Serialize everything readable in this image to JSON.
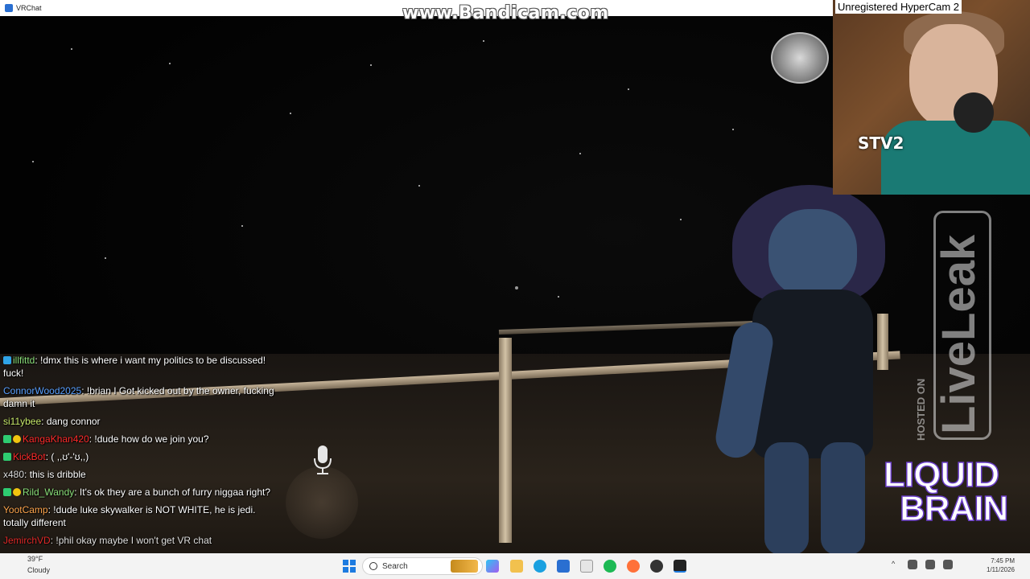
{
  "window": {
    "title": "VRChat"
  },
  "watermarks": {
    "bandicam": "www.Bandicam.com",
    "hypercam": "Unregistered HyperCam 2",
    "liveleak_hosted": "HOSTED ON",
    "liveleak": "LiveLeak",
    "liquid_brain_1": "LIQUID",
    "liquid_brain_2": "BRAIN",
    "stv": "STV2"
  },
  "chat": [
    {
      "user": "illfittd",
      "user_color": "#8be07a",
      "text": "!dmx this is where i want my politics to be discussed! fuck!"
    },
    {
      "user": "ConnorWood2025",
      "user_color": "#5aa0ff",
      "text": "!brian I Got kicked out by the owner, fucking damn it"
    },
    {
      "user": "si11ybee",
      "user_color": "#c7e86a",
      "text": "dang connor"
    },
    {
      "user": "KangaKhan420",
      "user_color": "#ff2b2b",
      "text": "!dude how do we join you?"
    },
    {
      "user": "KickBot",
      "user_color": "#ff2b2b",
      "text": "( ,,ʊ'-'ʊ,,)"
    },
    {
      "user": "x480",
      "user_color": "#dddddd",
      "text": "this is dribble"
    },
    {
      "user": "Rild_Wandy",
      "user_color": "#8be07a",
      "text": "It's ok they are a bunch of furry niggaa right?"
    },
    {
      "user": "YootCamp",
      "user_color": "#ffa64d",
      "text": "!dude luke skywalker is NOT WHITE, he is jedi. totally different"
    },
    {
      "user": "JemirchVD",
      "user_color": "#ff2b2b",
      "text": "!phil okay maybe I won't get VR chat"
    }
  ],
  "taskbar": {
    "weather_temp": "39°F",
    "weather_cond": "Cloudy",
    "search_placeholder": "Search",
    "clock_time": "7:45 PM",
    "clock_date": "1/11/2026"
  },
  "colors": {
    "taskbar_bg": "#f3f3f3",
    "accent": "#1d7be0"
  }
}
